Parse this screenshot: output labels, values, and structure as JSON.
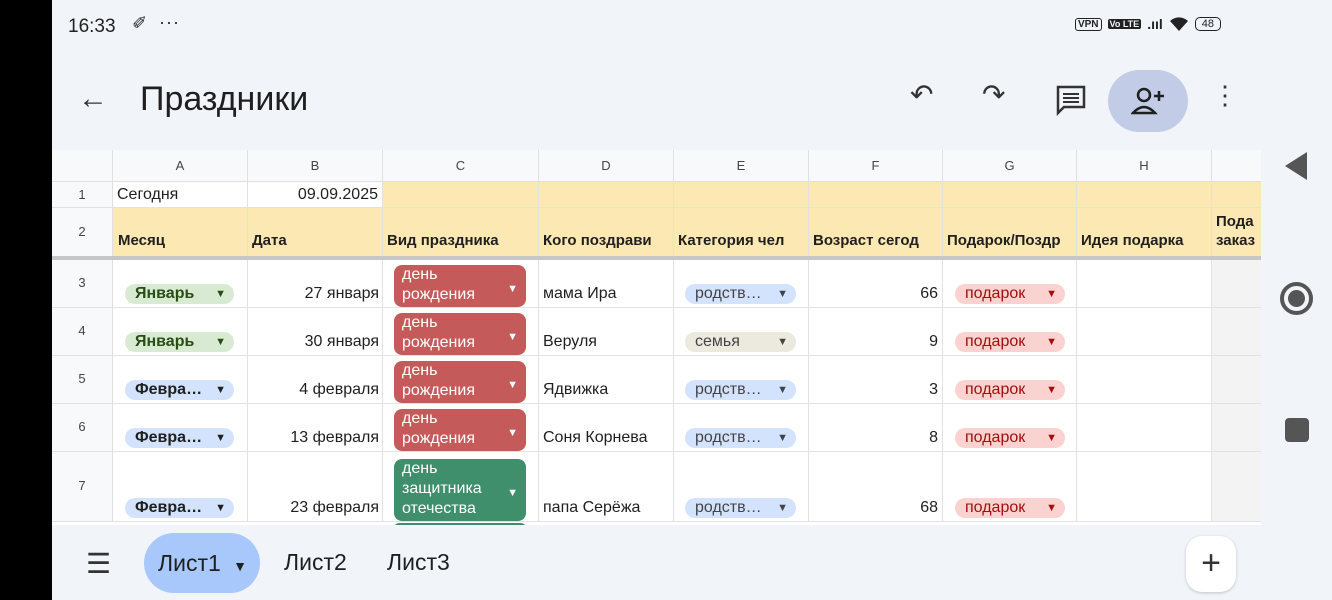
{
  "status_bar": {
    "time": "16:33",
    "notif_icon": "✐",
    "dots": "···",
    "vpn": "VPN",
    "volte": "Vo LTE",
    "signal": ".ııl",
    "wifi": "wifi",
    "battery": "48"
  },
  "app_bar": {
    "title": "Праздники"
  },
  "sheet": {
    "columns": [
      "A",
      "B",
      "C",
      "D",
      "E",
      "F",
      "G",
      "H"
    ],
    "row_numbers": [
      "1",
      "2",
      "3",
      "4",
      "5",
      "6",
      "7"
    ],
    "row1": {
      "a": "Сегодня",
      "b": "09.09.2025"
    },
    "headers": [
      "Месяц",
      "Дата",
      "Вид праздника",
      "Кого поздрави",
      "Категория чел",
      "Возраст сегод",
      "Подарок/Поздр",
      "Идея подарка",
      "Пода",
      "заказ"
    ],
    "rows": [
      {
        "month": "Январь",
        "month_type": "jan",
        "date": "27 января",
        "holiday": [
          "день",
          "рождения"
        ],
        "holiday_color": "red",
        "who": "мама Ира",
        "category": "родств…",
        "category_type": "rel",
        "age": "66",
        "gift": "подарок"
      },
      {
        "month": "Январь",
        "month_type": "jan",
        "date": "30 января",
        "holiday": [
          "день",
          "рождения"
        ],
        "holiday_color": "red",
        "who": "Веруля",
        "category": "семья",
        "category_type": "fam",
        "age": "9",
        "gift": "подарок"
      },
      {
        "month": "Февра…",
        "month_type": "feb",
        "date": "4 февраля",
        "holiday": [
          "день",
          "рождения"
        ],
        "holiday_color": "red",
        "who": "Ядвижка",
        "category": "родств…",
        "category_type": "rel",
        "age": "3",
        "gift": "подарок"
      },
      {
        "month": "Февра…",
        "month_type": "feb",
        "date": "13 февраля",
        "holiday": [
          "день",
          "рождения"
        ],
        "holiday_color": "red",
        "who": "Соня Корнева",
        "category": "родств…",
        "category_type": "rel",
        "age": "8",
        "gift": "подарок"
      },
      {
        "month": "Февра…",
        "month_type": "feb",
        "date": "23 февраля",
        "holiday": [
          "день",
          "защитника",
          "отечества"
        ],
        "holiday_color": "green",
        "who": "папа Серёжа",
        "category": "родств…",
        "category_type": "rel",
        "age": "68",
        "gift": "подарок"
      }
    ]
  },
  "bottom_bar": {
    "tabs": [
      "Лист1",
      "Лист2",
      "Лист3"
    ],
    "add": "+"
  },
  "colors": {
    "header_yellow": "#fce8b2",
    "chip_jan": "#d9ead3",
    "chip_feb": "#d3e3fd",
    "chip_gift": "#fad2cf",
    "holiday_red": "#c55a5a",
    "holiday_green": "#3f8f6c",
    "active_tab": "#a8c7fa"
  }
}
